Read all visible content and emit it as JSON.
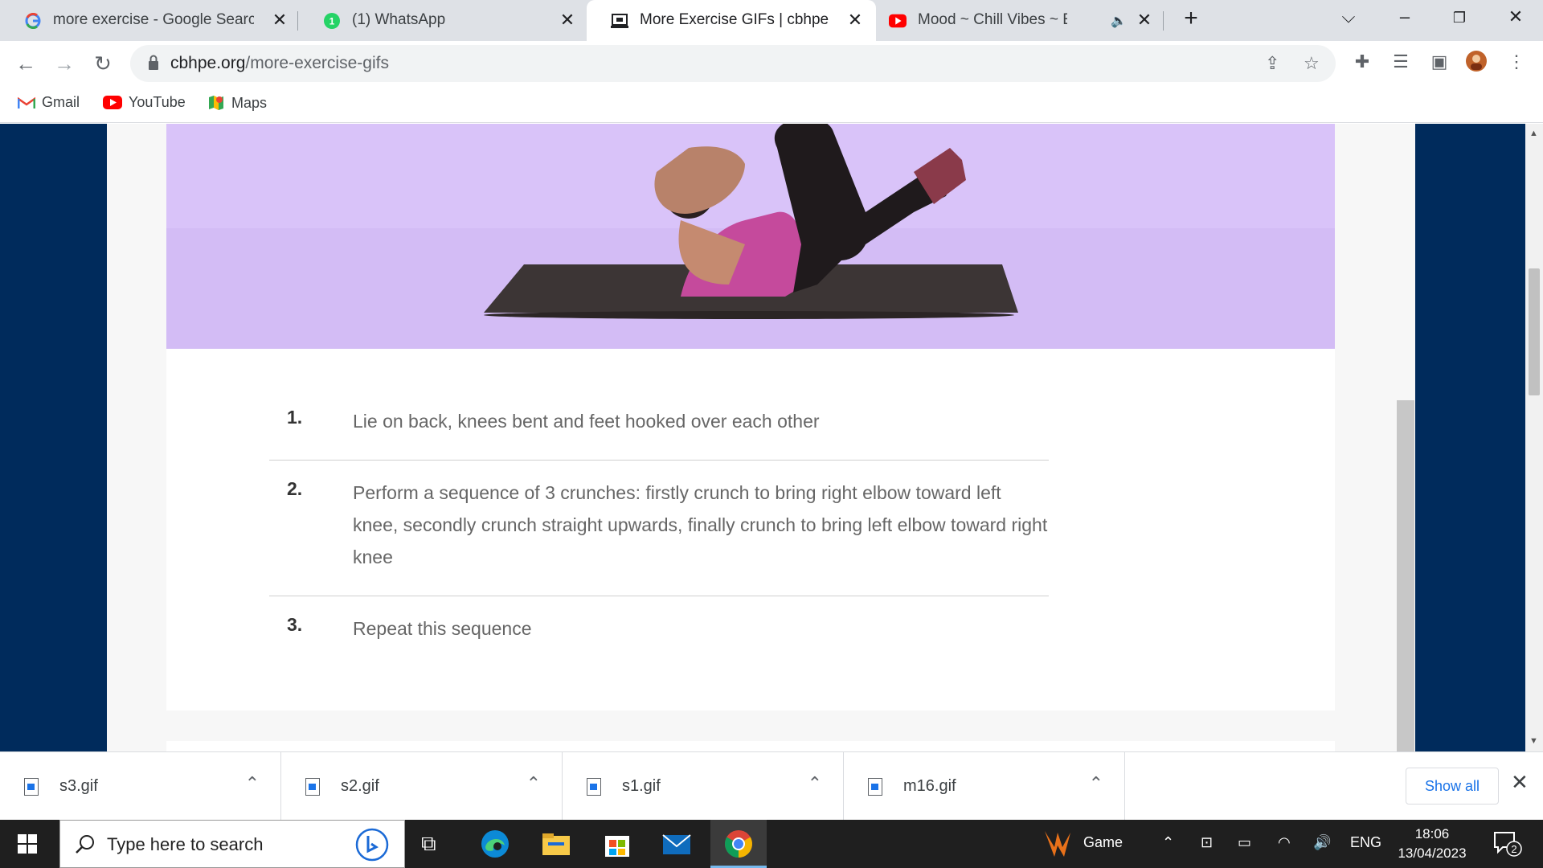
{
  "browser": {
    "tabs": [
      {
        "title": "more exercise - Google Search",
        "icon": "google-icon"
      },
      {
        "title": "(1) WhatsApp",
        "icon": "whatsapp-icon",
        "badge": "1"
      },
      {
        "title": "More Exercise GIFs | cbhpe",
        "icon": "site-icon",
        "active": true
      },
      {
        "title": "Mood ~ Chill Vibes ~ English",
        "icon": "youtube-icon"
      }
    ],
    "new_tab": "+",
    "url_host": "cbhpe.org",
    "url_path": "/more-exercise-gifs",
    "bookmarks": [
      {
        "label": "Gmail",
        "icon": "gmail-icon"
      },
      {
        "label": "YouTube",
        "icon": "youtube-icon"
      },
      {
        "label": "Maps",
        "icon": "maps-icon"
      }
    ]
  },
  "page": {
    "steps": [
      {
        "num": "1.",
        "text": "Lie on back, knees bent and feet hooked over each other"
      },
      {
        "num": "2.",
        "text": "Perform a sequence of 3 crunches: firstly crunch to bring right elbow toward left knee, secondly crunch straight upwards, finally crunch to bring left elbow toward right knee"
      },
      {
        "num": "3.",
        "text": "Repeat this sequence"
      }
    ],
    "colors": {
      "hero_bg": "#d9c3f9",
      "side_bg": "#002b5c"
    }
  },
  "downloads": {
    "items": [
      {
        "name": "s3.gif"
      },
      {
        "name": "s2.gif"
      },
      {
        "name": "s1.gif"
      },
      {
        "name": "m16.gif"
      }
    ],
    "show_all": "Show all"
  },
  "taskbar": {
    "search_placeholder": "Type here to search",
    "game_label": "Game",
    "language": "ENG",
    "time": "18:06",
    "date": "13/04/2023",
    "notifications": "2"
  }
}
